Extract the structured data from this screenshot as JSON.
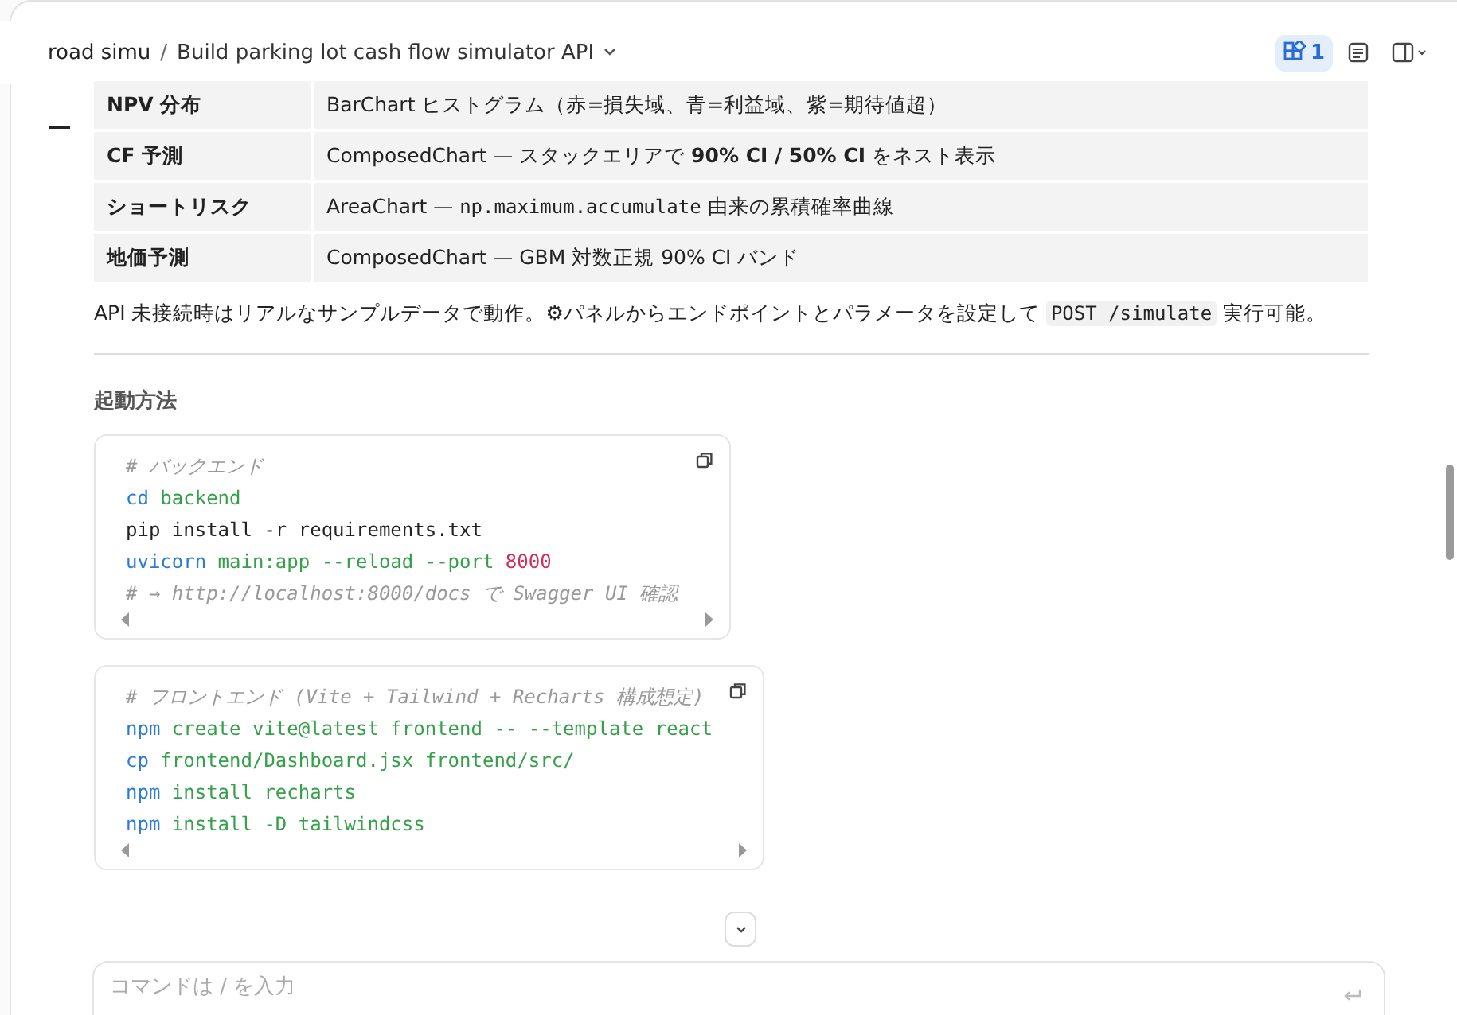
{
  "header": {
    "project": "road simu",
    "separator": "/",
    "title": "Build parking lot cash flow simulator API",
    "artifact_count": "1"
  },
  "table": {
    "rows": [
      {
        "label": "NPV 分布",
        "description": [
          {
            "kind": "text",
            "text": "BarChart ヒストグラム（赤=損失域、青=利益域、紫=期待値超）"
          }
        ]
      },
      {
        "label": "CF 予測",
        "description": [
          {
            "kind": "text",
            "text": "ComposedChart — スタックエリアで "
          },
          {
            "kind": "bold",
            "text": "90% CI / 50% CI"
          },
          {
            "kind": "text",
            "text": " をネスト表示"
          }
        ]
      },
      {
        "label": "ショートリスク",
        "description": [
          {
            "kind": "text",
            "text": "AreaChart — "
          },
          {
            "kind": "code",
            "text": "np.maximum.accumulate"
          },
          {
            "kind": "text",
            "text": " 由来の累積確率曲線"
          }
        ]
      },
      {
        "label": "地価予測",
        "description": [
          {
            "kind": "text",
            "text": "ComposedChart — GBM 対数正規 90% CI バンド"
          }
        ]
      }
    ]
  },
  "note": [
    {
      "kind": "text",
      "text": "API 未接続時はリアルなサンプルデータで動作。⚙パネルからエンドポイントとパラメータを設定して "
    },
    {
      "kind": "code",
      "text": "POST /simulate"
    },
    {
      "kind": "text",
      "text": " 実行可能。"
    }
  ],
  "section_heading": "起動方法",
  "code_blocks": [
    {
      "lines": [
        [
          {
            "kind": "comment",
            "text": "# バックエンド"
          }
        ],
        [
          {
            "kind": "command",
            "text": "cd"
          },
          {
            "kind": "arg",
            "text": " backend"
          }
        ],
        [
          {
            "kind": "plain",
            "text": "pip install -r requirements.txt"
          }
        ],
        [
          {
            "kind": "command",
            "text": "uvicorn"
          },
          {
            "kind": "arg",
            "text": " main:app --reload --port"
          },
          {
            "kind": "number",
            "text": " 8000"
          }
        ],
        [
          {
            "kind": "comment",
            "text": "# → http://localhost:8000/docs で Swagger UI 確認"
          }
        ]
      ]
    },
    {
      "lines": [
        [
          {
            "kind": "comment",
            "text": "# フロントエンド (Vite + Tailwind + Recharts 構成想定)"
          }
        ],
        [
          {
            "kind": "command",
            "text": "npm"
          },
          {
            "kind": "arg",
            "text": " create vite@latest frontend -- --template react"
          }
        ],
        [
          {
            "kind": "command",
            "text": "cp"
          },
          {
            "kind": "arg",
            "text": " frontend/Dashboard.jsx frontend/src/"
          }
        ],
        [
          {
            "kind": "command",
            "text": "npm"
          },
          {
            "kind": "arg",
            "text": " install recharts"
          }
        ],
        [
          {
            "kind": "command",
            "text": "npm"
          },
          {
            "kind": "arg",
            "text": " install -D tailwindcss"
          }
        ]
      ]
    }
  ],
  "input": {
    "placeholder": "コマンドは / を入力"
  }
}
